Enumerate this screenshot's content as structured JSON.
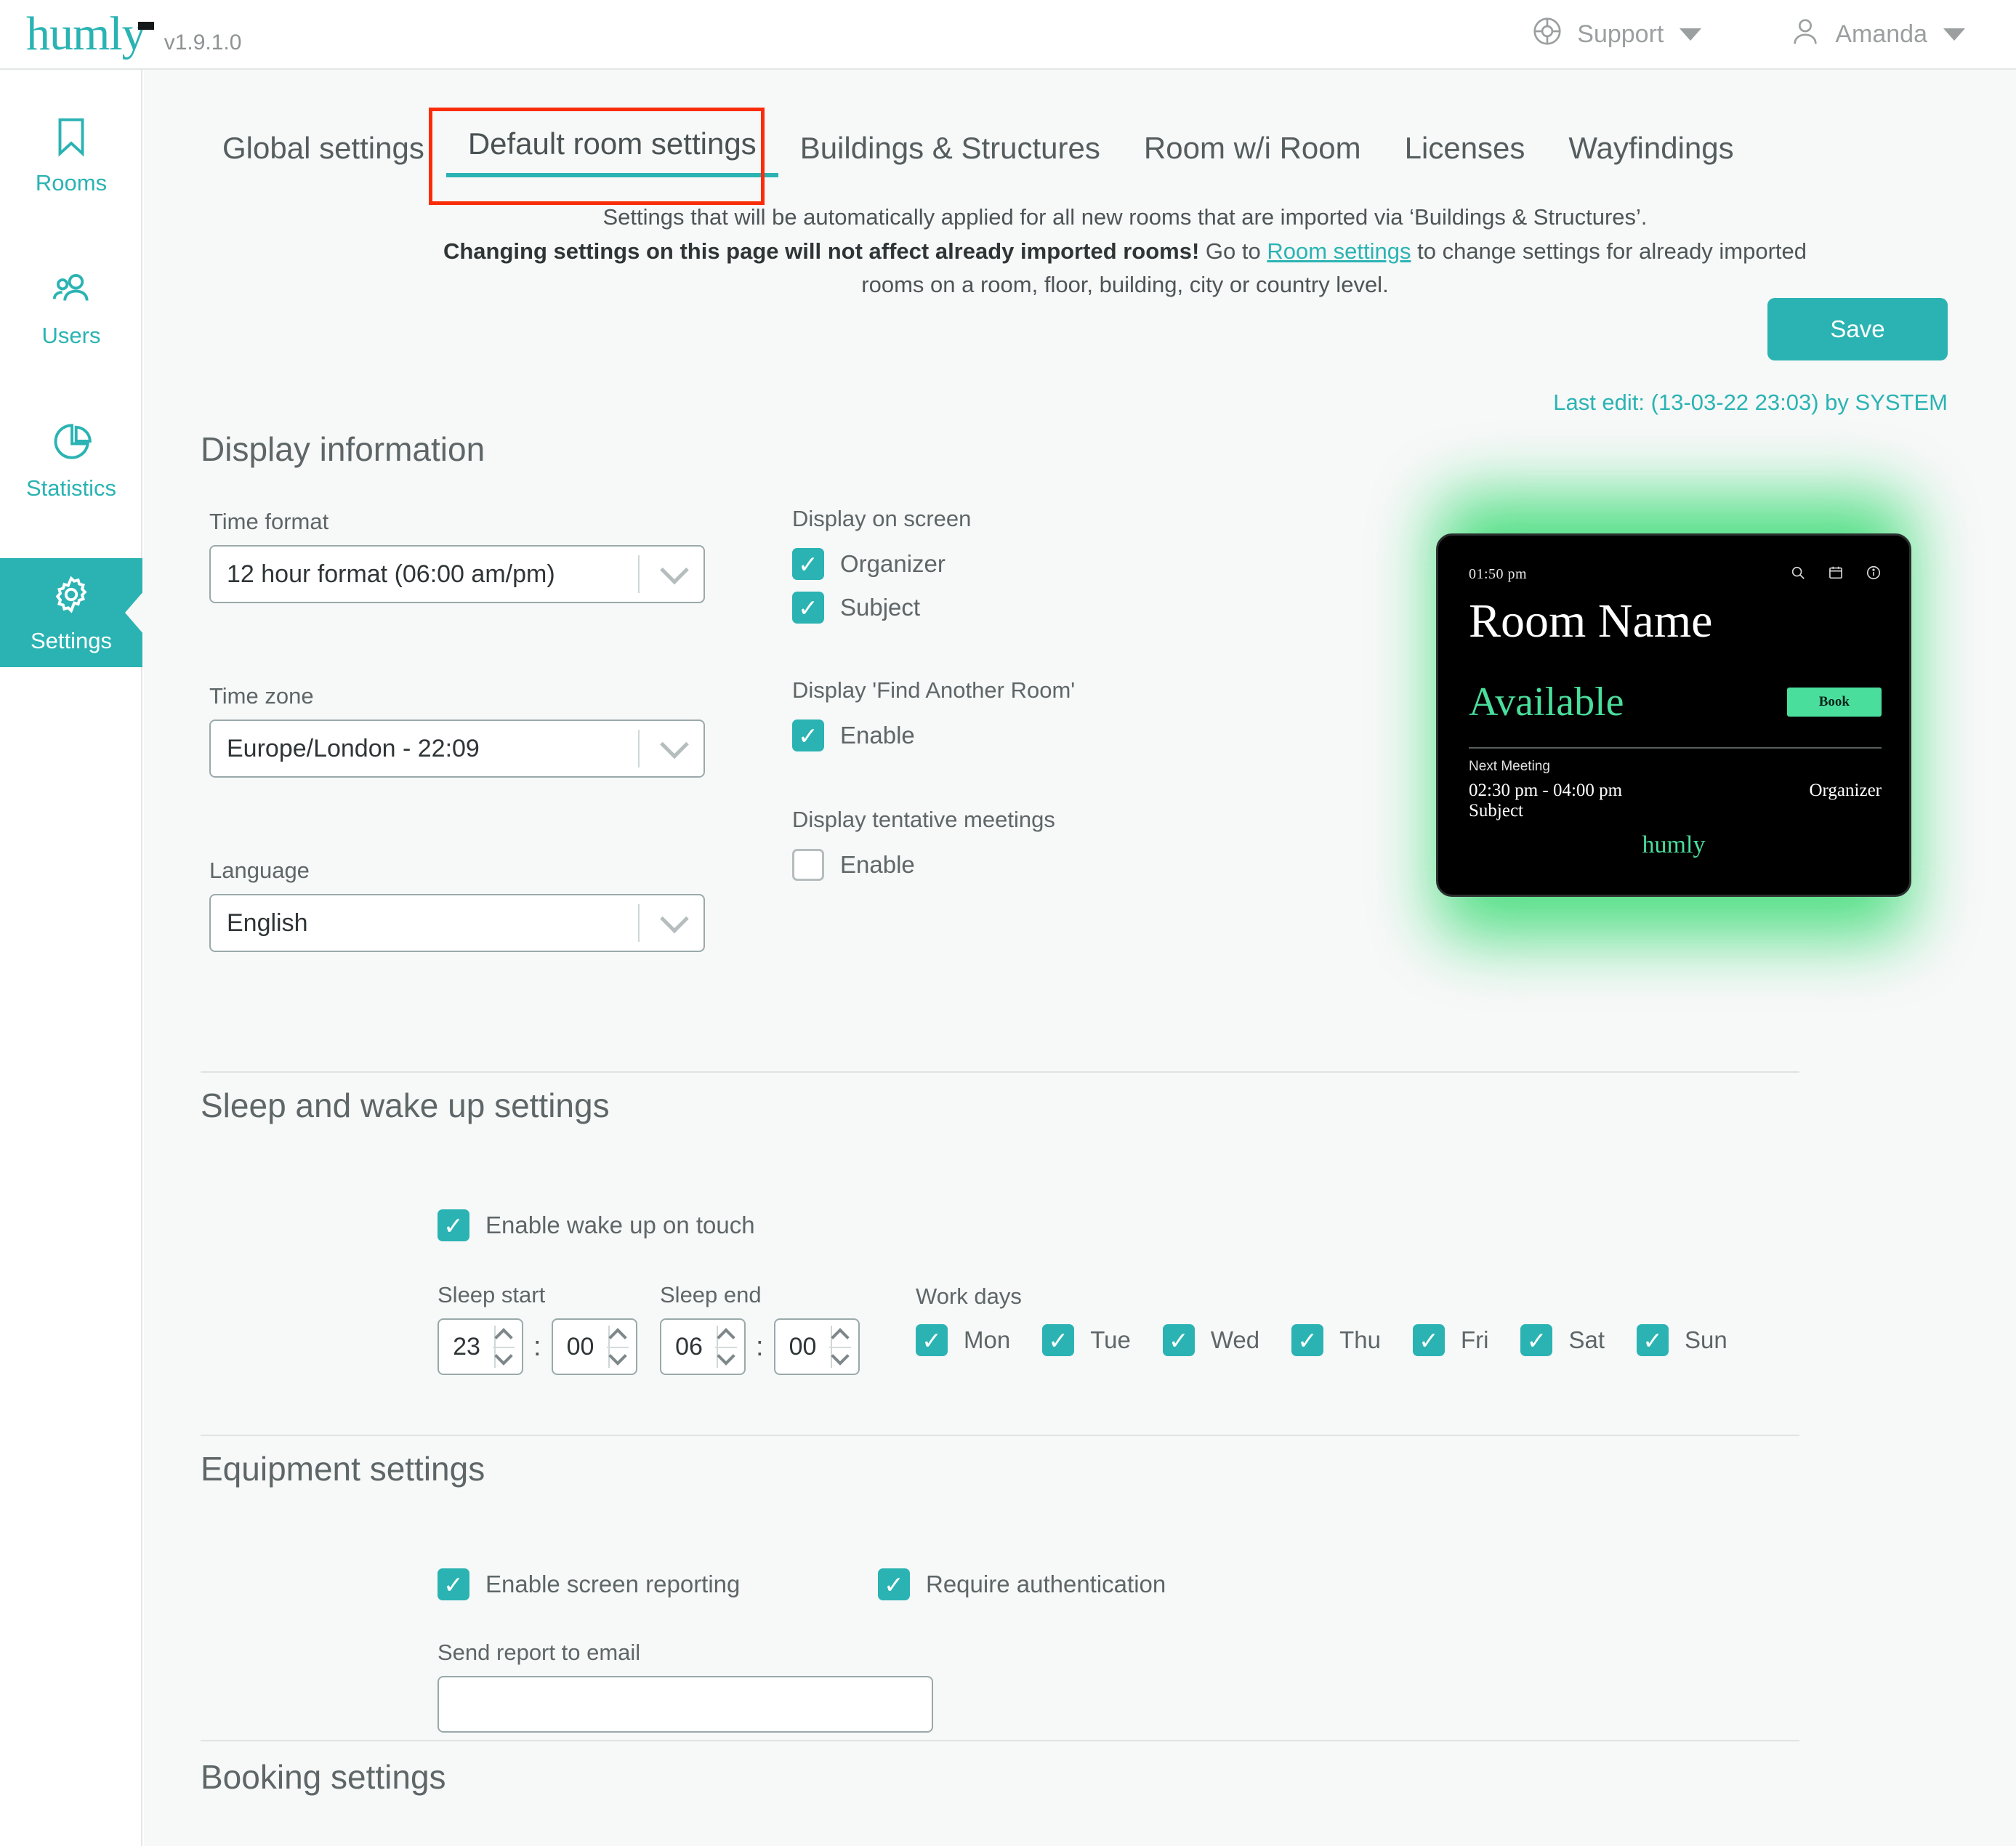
{
  "topbar": {
    "logo": "humly",
    "version": "v1.9.1.0",
    "support_label": "Support",
    "user_label": "Amanda"
  },
  "sidebar": {
    "items": [
      {
        "label": "Rooms",
        "icon": "bookmark-icon",
        "active": false
      },
      {
        "label": "Users",
        "icon": "users-icon",
        "active": false
      },
      {
        "label": "Statistics",
        "icon": "pie-chart-icon",
        "active": false
      },
      {
        "label": "Settings",
        "icon": "gear-icon",
        "active": true
      }
    ]
  },
  "tabs": [
    {
      "label": "Global settings",
      "active": false
    },
    {
      "label": "Default room settings",
      "active": true
    },
    {
      "label": "Buildings & Structures",
      "active": false
    },
    {
      "label": "Room w/i Room",
      "active": false
    },
    {
      "label": "Licenses",
      "active": false
    },
    {
      "label": "Wayfindings",
      "active": false
    }
  ],
  "header": {
    "desc_line1": "Settings that will be automatically applied for all new rooms that are imported via ‘Buildings & Structures’.",
    "desc_bold": "Changing settings on this page will not affect already imported rooms!",
    "desc_mid": " Go to ",
    "desc_link": "Room settings",
    "desc_after_link": " to change settings for already imported",
    "desc_line3": "rooms on a room, floor, building, city or country level.",
    "save_label": "Save",
    "last_edit": "Last edit: (13-03-22 23:03) by SYSTEM"
  },
  "display_information": {
    "title": "Display information",
    "time_format": {
      "label": "Time format",
      "value": "12 hour format (06:00 am/pm)"
    },
    "time_zone": {
      "label": "Time zone",
      "value": "Europe/London - 22:09"
    },
    "language": {
      "label": "Language",
      "value": "English"
    },
    "display_on_screen": {
      "label": "Display on screen",
      "options": [
        {
          "label": "Organizer",
          "checked": true
        },
        {
          "label": "Subject",
          "checked": true
        }
      ]
    },
    "find_another_room": {
      "label": "Display 'Find Another Room'",
      "options": [
        {
          "label": "Enable",
          "checked": true
        }
      ]
    },
    "tentative_meetings": {
      "label": "Display tentative meetings",
      "options": [
        {
          "label": "Enable",
          "checked": false
        }
      ]
    }
  },
  "device_preview": {
    "time": "01:50 pm",
    "icons": [
      "search-icon",
      "calendar-icon",
      "info-icon"
    ],
    "room_name": "Room Name",
    "status": "Available",
    "book_label": "Book",
    "next_meeting_label": "Next Meeting",
    "next_meeting_time": "02:30 pm - 04:00 pm",
    "next_meeting_subject": "Subject",
    "organizer": "Organizer",
    "logo": "humly",
    "glow_color": "#4ade80",
    "accent_color": "#4ade9c"
  },
  "sleep_settings": {
    "title": "Sleep and wake up settings",
    "wake_on_touch": {
      "label": "Enable wake up on touch",
      "checked": true
    },
    "sleep_start": {
      "label": "Sleep start",
      "hour": "23",
      "minute": "00"
    },
    "sleep_end": {
      "label": "Sleep end",
      "hour": "06",
      "minute": "00"
    },
    "work_days": {
      "label": "Work days",
      "days": [
        {
          "label": "Mon",
          "checked": true
        },
        {
          "label": "Tue",
          "checked": true
        },
        {
          "label": "Wed",
          "checked": true
        },
        {
          "label": "Thu",
          "checked": true
        },
        {
          "label": "Fri",
          "checked": true
        },
        {
          "label": "Sat",
          "checked": true
        },
        {
          "label": "Sun",
          "checked": true
        }
      ]
    },
    "colon": ":"
  },
  "equipment_settings": {
    "title": "Equipment settings",
    "screen_reporting": {
      "label": "Enable screen reporting",
      "checked": true
    },
    "require_auth": {
      "label": "Require authentication",
      "checked": true
    },
    "email": {
      "label": "Send report to email",
      "value": "",
      "placeholder": ""
    }
  },
  "booking_settings": {
    "title": "Booking settings"
  },
  "colors": {
    "accent": "#2bb3b3",
    "annotation": "#fa2d09",
    "background": "#f7f8f8"
  },
  "checkmark": "✓"
}
